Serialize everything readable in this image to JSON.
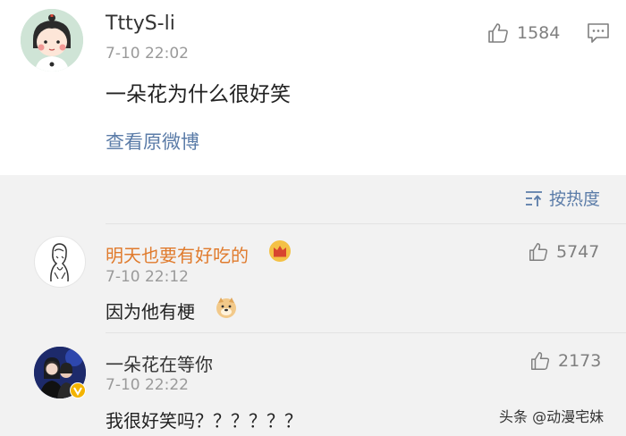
{
  "post": {
    "username": "TttyS-li",
    "timestamp": "7-10 22:02",
    "text": "一朵花为什么很好笑",
    "view_original": "查看原微博",
    "likes": "1584",
    "avatar_icon": "cartoon-girl-avatar",
    "comment_icon": "comment-icon"
  },
  "sort": {
    "label": "按热度",
    "icon": "sort-lines-icon"
  },
  "comments": [
    {
      "username": "明天也要有好吃的",
      "name_color": "#e07b2d",
      "badge_icon": "crown-badge-icon",
      "timestamp": "7-10 22:12",
      "text": "因为他有梗",
      "emoji_icon": "doge-emoji-icon",
      "likes": "5747"
    },
    {
      "username": "一朵花在等你",
      "name_color": "#333333",
      "badge_icon": "verified-v-badge-icon",
      "timestamp": "7-10 22:22",
      "text": "我很好笑吗？？？？？？",
      "likes": "2173"
    }
  ],
  "watermark": "头条 @动漫宅妹",
  "colors": {
    "link": "#5b7ca8",
    "muted": "#9a9a9a",
    "background": "#f2f2f2",
    "card": "#ffffff"
  }
}
